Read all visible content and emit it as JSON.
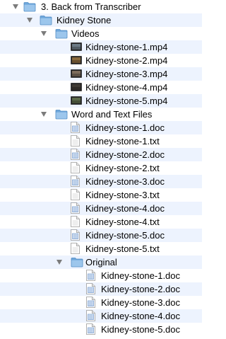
{
  "tree": [
    {
      "name": "3. Back from Transcriber",
      "kind": "folder",
      "depth": 0,
      "expanded": true
    },
    {
      "name": "Kidney Stone",
      "kind": "folder",
      "depth": 1,
      "expanded": true
    },
    {
      "name": "Videos",
      "kind": "folder",
      "depth": 2,
      "expanded": true
    },
    {
      "name": "Kidney-stone-1.mp4",
      "kind": "video",
      "depth": 3
    },
    {
      "name": "Kidney-stone-2.mp4",
      "kind": "video",
      "depth": 3
    },
    {
      "name": "Kidney-stone-3.mp4",
      "kind": "video",
      "depth": 3
    },
    {
      "name": "Kidney-stone-4.mp4",
      "kind": "video",
      "depth": 3
    },
    {
      "name": "Kidney-stone-5.mp4",
      "kind": "video",
      "depth": 3
    },
    {
      "name": "Word and Text Files",
      "kind": "folder",
      "depth": 2,
      "expanded": true
    },
    {
      "name": "Kidney-stone-1.doc",
      "kind": "doc",
      "depth": 3
    },
    {
      "name": "Kidney-stone-1.txt",
      "kind": "txt",
      "depth": 3
    },
    {
      "name": "Kidney-stone-2.doc",
      "kind": "doc",
      "depth": 3
    },
    {
      "name": "Kidney-stone-2.txt",
      "kind": "txt",
      "depth": 3
    },
    {
      "name": "Kidney-stone-3.doc",
      "kind": "doc",
      "depth": 3
    },
    {
      "name": "Kidney-stone-3.txt",
      "kind": "txt",
      "depth": 3
    },
    {
      "name": "Kidney-stone-4.doc",
      "kind": "doc",
      "depth": 3
    },
    {
      "name": "Kidney-stone-4.txt",
      "kind": "txt",
      "depth": 3
    },
    {
      "name": "Kidney-stone-5.doc",
      "kind": "doc",
      "depth": 3
    },
    {
      "name": "Kidney-stone-5.txt",
      "kind": "txt",
      "depth": 3
    },
    {
      "name": "Original",
      "kind": "folder",
      "depth": 3,
      "expanded": true
    },
    {
      "name": "Kidney-stone-1.doc",
      "kind": "doc",
      "depth": 4
    },
    {
      "name": "Kidney-stone-2.doc",
      "kind": "doc",
      "depth": 4
    },
    {
      "name": "Kidney-stone-3.doc",
      "kind": "doc",
      "depth": 4
    },
    {
      "name": "Kidney-stone-4.doc",
      "kind": "doc",
      "depth": 4
    },
    {
      "name": "Kidney-stone-5.doc",
      "kind": "doc",
      "depth": 4
    }
  ],
  "colors": {
    "stripe": "#edf3fe",
    "folder": "#7fb3e0",
    "triangle": "#7b7b7b"
  }
}
